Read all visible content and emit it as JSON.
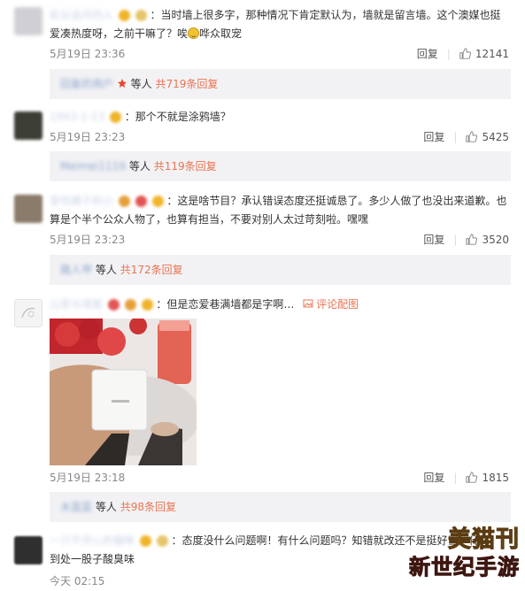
{
  "comments": [
    {
      "username": "彩云追月的人",
      "text": "当时墙上很多字，那种情况下肯定默认为，墙就是留言墙。这个澳媒也挺爱凑热度呀，之前干嘛了？唉",
      "text_tail": "哗众取宠",
      "date": "5月19日 23:36",
      "reply_label": "回复",
      "likes": "12141",
      "thread": {
        "name": "回复的用户",
        "prefix": "等人",
        "link": "共719条回复"
      }
    },
    {
      "username": "1993-1-13",
      "text": "那个不就是涂鸦墙？",
      "date": "5月19日 23:23",
      "reply_label": "回复",
      "likes": "5425",
      "thread": {
        "name": "Meimei1119",
        "prefix": "等人",
        "link": "共119条回复"
      }
    },
    {
      "username": "爱吃橘子的小",
      "text": "这是啥节目？承认错误态度还挺诚恳了。多少人做了也没出来道歉。也算是个半个公众人物了，也算有担当，不要对别人太过苛刻啦。嘿嘿",
      "date": "5月19日 23:23",
      "reply_label": "回复",
      "likes": "3520",
      "thread": {
        "name": "路人甲",
        "prefix": "等人",
        "link": "共172条回复"
      }
    },
    {
      "username": "山茶与鸢尾",
      "text": "但是恋爱巷满墙都是字啊…",
      "pic_link": "评论配图",
      "date": "5月19日 23:18",
      "reply_label": "回复",
      "likes": "1815",
      "thread": {
        "name": "水蓝蓝",
        "prefix": "等人",
        "link": "共98条回复"
      }
    },
    {
      "username": "一只不开心的猫咪",
      "text": "态度没什么问题啊！有什么问题吗？知错就改还不是挺好当，什么到处一股子酸臭味",
      "date": "今天 02:15"
    }
  ],
  "watermark": {
    "line1": "美猫刊",
    "line2": "新世纪手游"
  },
  "icons": [
    "thumb-up-icon",
    "picture-icon",
    "fire-icon",
    "smile-emoji-icon"
  ],
  "colors": {
    "link": "#eb7350",
    "reply_bg": "#f2f2f5",
    "date": "#888888"
  }
}
